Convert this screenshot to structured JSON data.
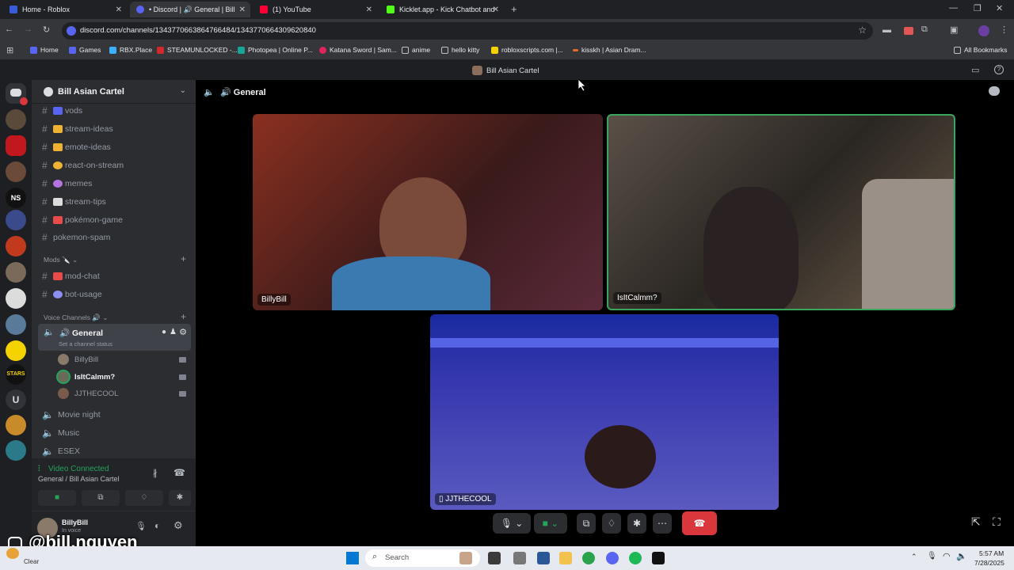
{
  "browser": {
    "tabs": [
      {
        "label": "Home - Roblox",
        "active": false
      },
      {
        "label": "• Discord | 🔊 General | Bill",
        "active": true
      },
      {
        "label": "(1) YouTube",
        "active": false
      },
      {
        "label": "Kicklet.app - Kick Chatbot and",
        "active": false
      }
    ],
    "url": "discord.com/channels/1343770663864766484/1343770664309620840",
    "bookmarks": [
      "Home",
      "Games",
      "RBX.Place",
      "STEAMUNLOCKED -...",
      "Photopea | Online P...",
      "Katana Sword | Sam...",
      "anime",
      "hello kitty",
      "robloxscripts.com |...",
      "kisskh | Asian Dram..."
    ],
    "all_bookmarks": "All Bookmarks"
  },
  "discord": {
    "server_title": "Bill Asian Cartel",
    "server_name": "Bill Asian Cartel",
    "header_channel": "General",
    "text_channels": [
      {
        "name": "vods",
        "emoji_color": "#5865f2"
      },
      {
        "name": "stream-ideas",
        "emoji_color": "#f0b232"
      },
      {
        "name": "emote-ideas",
        "emoji_color": "#f0b232"
      },
      {
        "name": "react-on-stream",
        "emoji_color": "#f0b232"
      },
      {
        "name": "memes",
        "emoji_color": "#b473e0"
      },
      {
        "name": "stream-tips",
        "emoji_color": "#dcdcdc"
      },
      {
        "name": "pokémon-game",
        "emoji_color": "#e94b4b"
      },
      {
        "name": "pokemon-spam",
        "emoji_color": ""
      }
    ],
    "mods_category": "Mods 🔪",
    "mod_channels": [
      {
        "name": "mod-chat",
        "emoji_color": "#e94b4b"
      },
      {
        "name": "bot-usage",
        "emoji_color": "#8a8ff0"
      }
    ],
    "voice_category": "Voice Channels 🔊",
    "voice_channels": {
      "active": {
        "name": "General",
        "status": "Set a channel status"
      },
      "users": [
        {
          "name": "BillyBill",
          "bold": false
        },
        {
          "name": "IsItCalmm?",
          "bold": true
        },
        {
          "name": "JJTHECOOL",
          "bold": false
        }
      ],
      "others": [
        "Movie night",
        "Music",
        "ESEX"
      ]
    },
    "voice_panel": {
      "status": "Video Connected",
      "location": "General / Bill Asian Cartel"
    },
    "user_panel": {
      "name": "BillyBill",
      "status": "In voice"
    },
    "video_tiles": [
      {
        "name": "BillyBill"
      },
      {
        "name": "IsItCalmm?"
      },
      {
        "name": "JJTHECOOL"
      }
    ]
  },
  "overlay": {
    "watermark": "@bill.nguyen"
  },
  "taskbar": {
    "search_placeholder": "Search",
    "time": "5:57 AM",
    "date": "7/28/2025",
    "weather": "Clear"
  },
  "colors": {
    "discord_green": "#23a55a",
    "end_call_red": "#da373c",
    "speaking_border": "#3ba55d"
  }
}
